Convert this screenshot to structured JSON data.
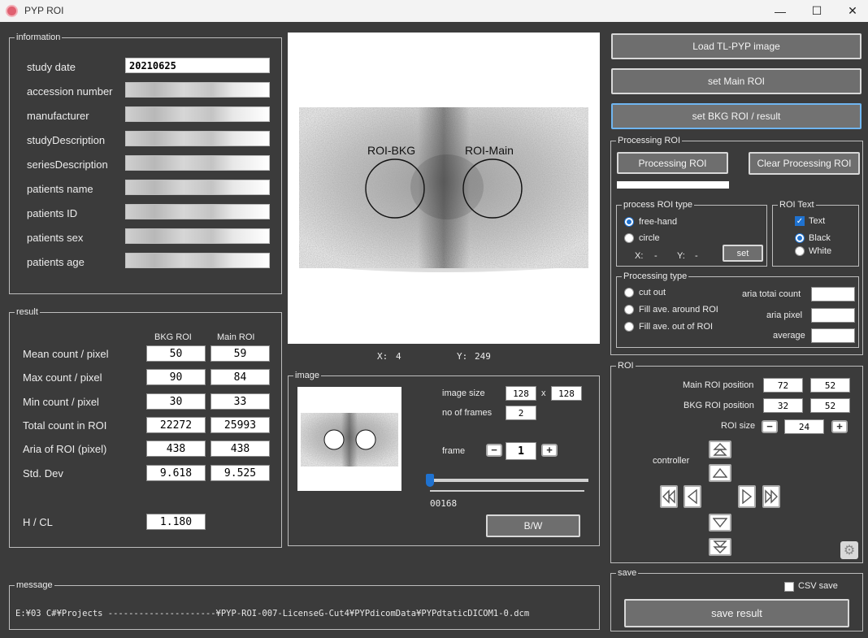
{
  "window": {
    "title": "PYP ROI",
    "minimize": "—",
    "maximize": "☐",
    "close": "✕"
  },
  "information": {
    "title": "information",
    "rows": [
      {
        "label": "study date",
        "value": "20210625"
      },
      {
        "label": "accession number",
        "value": ""
      },
      {
        "label": "manufacturer",
        "value": ""
      },
      {
        "label": "studyDescription",
        "value": ""
      },
      {
        "label": "seriesDescription",
        "value": ""
      },
      {
        "label": "patients name",
        "value": ""
      },
      {
        "label": "patients ID",
        "value": ""
      },
      {
        "label": "patients sex",
        "value": ""
      },
      {
        "label": "patients age",
        "value": ""
      }
    ]
  },
  "result": {
    "title": "result",
    "col_bkg": "BKG ROI",
    "col_main": "Main ROI",
    "rows": [
      {
        "label": "Mean count / pixel",
        "bkg": "50",
        "main": "59"
      },
      {
        "label": "Max count / pixel",
        "bkg": "90",
        "main": "84"
      },
      {
        "label": "Min count / pixel",
        "bkg": "30",
        "main": "33"
      },
      {
        "label": "Total count in ROI",
        "bkg": "22272",
        "main": "25993"
      },
      {
        "label": "Aria of  ROI (pixel)",
        "bkg": "438",
        "main": "438"
      },
      {
        "label": "Std. Dev",
        "bkg": "9.618",
        "main": "9.525"
      }
    ],
    "hcl_label": "H / CL",
    "hcl_value": "1.180"
  },
  "viewer": {
    "roi_bkg_label": "ROI-BKG",
    "roi_main_label": "ROI-Main",
    "x_label": "X:",
    "x_value": "4",
    "y_label": "Y:",
    "y_value": "249"
  },
  "image_panel": {
    "title": "image",
    "size_label": "image size",
    "size_w": "128",
    "size_x": "x",
    "size_h": "128",
    "frames_label": "no of frames",
    "frames_value": "2",
    "frame_label": "frame",
    "frame_value": "1",
    "minus": "−",
    "plus": "+",
    "slider_value_text": "00168",
    "slider_fraction": 0.0,
    "bw_button": "B/W"
  },
  "message": {
    "title": "message",
    "text": "E:¥03 C#¥Projects ---------------------¥PYP-ROI-007-LicenseG-Cut4¥PYPdicomData¥PYPdtaticDICOM1-0.dcm"
  },
  "buttons": {
    "load": "Load TL-PYP image",
    "set_main": "set Main ROI",
    "set_bkg": "set BKG ROI / result"
  },
  "processing": {
    "title": "Processing ROI",
    "processing_button": "Processing ROI",
    "clear_button": "Clear Processing ROI",
    "roi_type_title": "process ROI type",
    "free_hand": "free-hand",
    "circle": "circle",
    "x_label": "X:",
    "x_value": "-",
    "y_label": "Y:",
    "y_value": "-",
    "set_button": "set",
    "roi_text_title": "ROI Text",
    "text_opt": "Text",
    "black_opt": "Black",
    "white_opt": "White",
    "type_title": "Processing type",
    "cut_out": "cut out",
    "fill_around": "Fill ave. around ROI",
    "fill_out": "Fill ave. out of ROI",
    "total_count_label": "aria totai count",
    "pixel_label": "aria pixel",
    "average_label": "average",
    "total_count_value": "",
    "pixel_value": "",
    "average_value": ""
  },
  "roi": {
    "title": "ROI",
    "main_pos_label": "Main ROI position",
    "main_x": "72",
    "main_y": "52",
    "bkg_pos_label": "BKG ROI position",
    "bkg_x": "32",
    "bkg_y": "52",
    "size_label": "ROI size",
    "size_value": "24",
    "minus": "−",
    "plus": "+",
    "controller_label": "controller"
  },
  "save": {
    "title": "save",
    "csv_label": "CSV save",
    "save_button": "save result"
  },
  "colors": {
    "background": "#3b3b3b",
    "button": "#6e6e6e",
    "accent": "#1f72d0",
    "active_border": "#6fb5f0"
  }
}
